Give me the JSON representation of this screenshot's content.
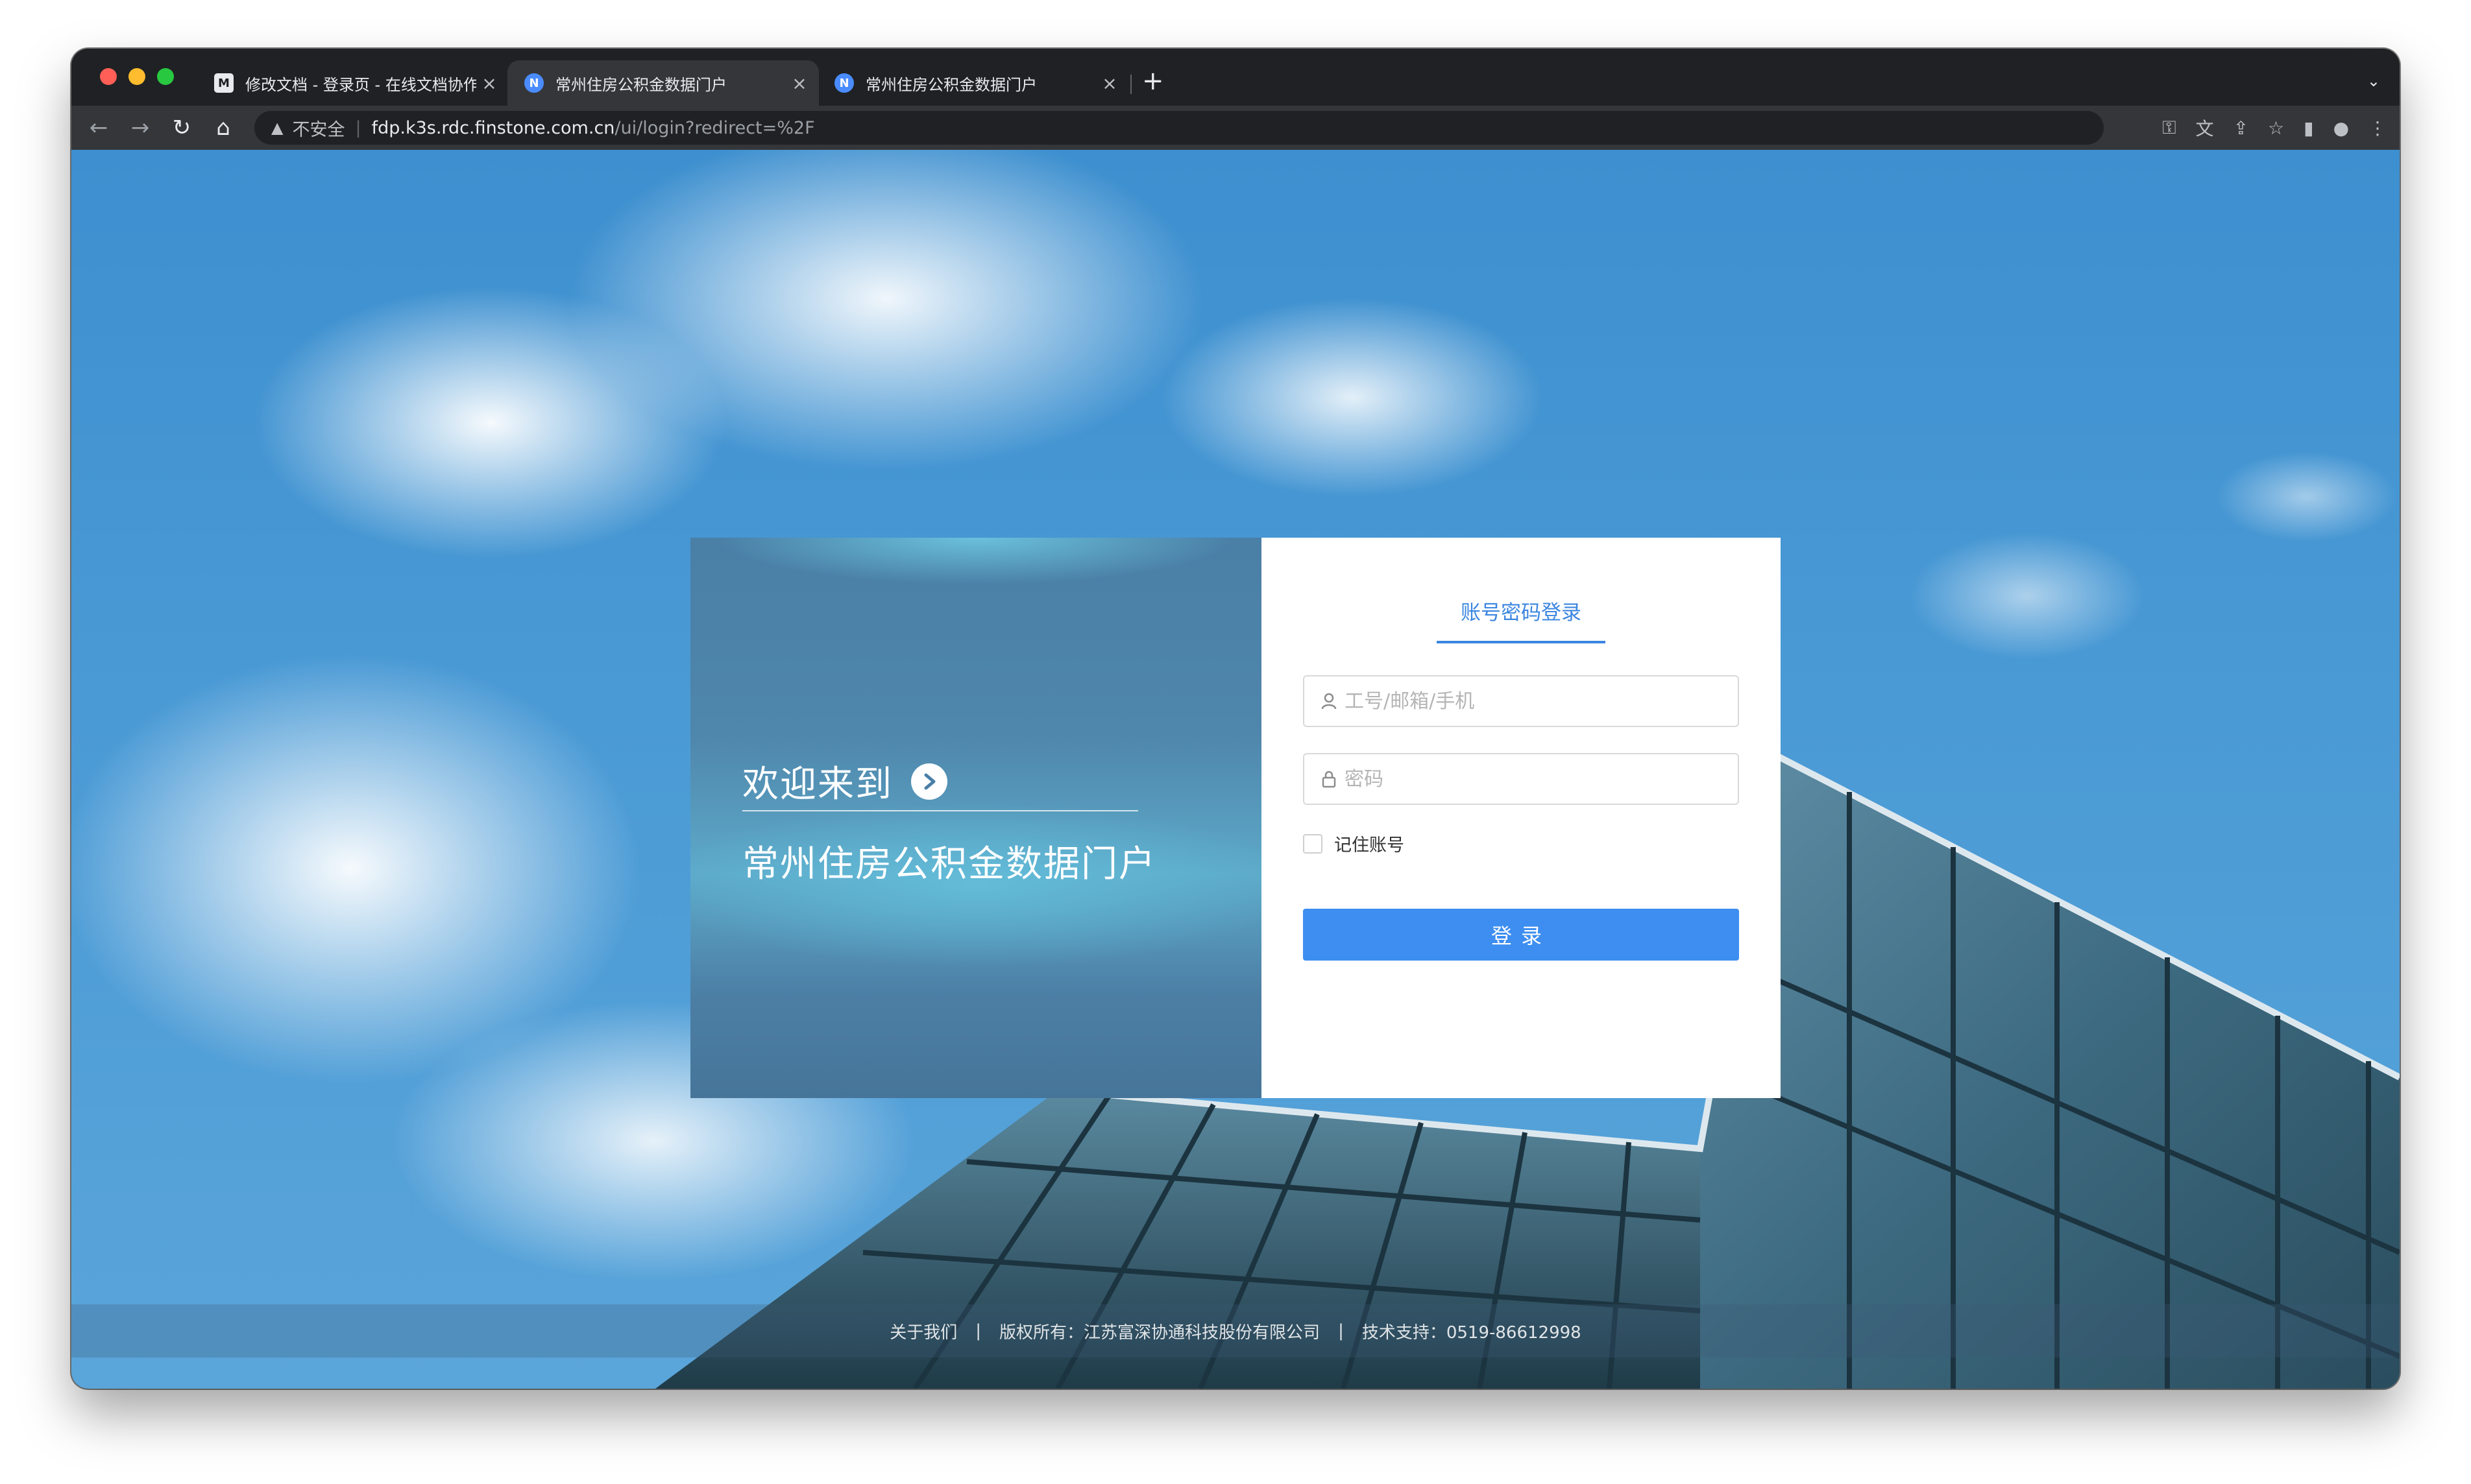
{
  "browser": {
    "tabs": [
      {
        "title": "修改文档 - 登录页 - 在线文档协作",
        "favicon": "doc-icon",
        "active": false
      },
      {
        "title": "常州住房公积金数据门户",
        "favicon": "N",
        "active": true
      },
      {
        "title": "常州住房公积金数据门户",
        "favicon": "N",
        "active": false
      }
    ],
    "address": {
      "security_label": "不安全",
      "host": "fdp.k3s.rdc.finstone.com.cn",
      "path": "/ui/login?redirect=%2F"
    }
  },
  "login": {
    "welcome": "欢迎来到",
    "portal_name": "常州住房公积金数据门户",
    "tab_label": "账号密码登录",
    "username_placeholder": "工号/邮箱/手机",
    "password_placeholder": "密码",
    "remember_label": "记住账号",
    "submit_label": "登录"
  },
  "footer": {
    "about": "关于我们",
    "sep1": "|",
    "copyright": "版权所有：江苏富深协通科技股份有限公司",
    "sep2": "|",
    "support": "技术支持：0519-86612998"
  },
  "colors": {
    "accent": "#3d8ef0",
    "tab_text": "#3b86e0"
  }
}
